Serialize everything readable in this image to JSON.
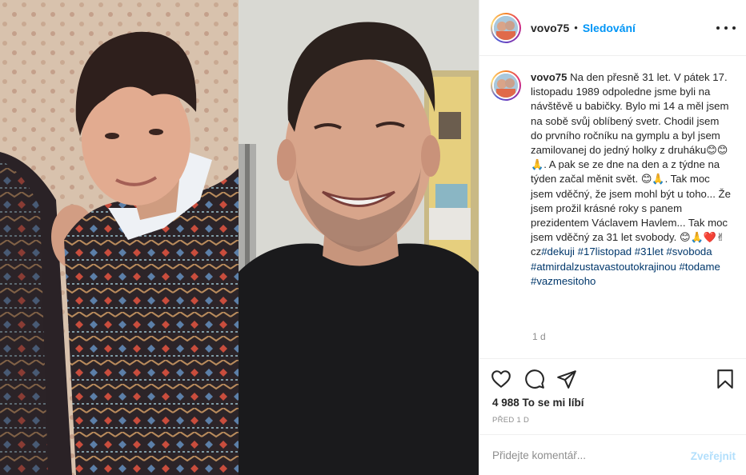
{
  "post": {
    "username": "vovo75",
    "separator": "•",
    "follow_label": "Sledování",
    "more_icon": "more-horizontal-icon"
  },
  "caption": {
    "username": "vovo75",
    "segments": [
      {
        "type": "text",
        "text": "Na den přesně 31 let. V pátek 17. listopadu 1989 odpoledne jsme byli na návštěvě u babičky. Bylo mi 14 a měl jsem na sobě svůj oblíbený svetr. Chodil jsem do prvního ročníku na gymplu a byl jsem zamilovanej do jedný holky z druháku"
      },
      {
        "type": "emoji",
        "text": "😊"
      },
      {
        "type": "emoji",
        "text": "😊"
      },
      {
        "type": "emoji",
        "text": "🙏"
      },
      {
        "type": "text",
        "text": ". A pak se ze dne na den a z týdne na týden začal měnit svět. "
      },
      {
        "type": "emoji",
        "text": "😊"
      },
      {
        "type": "emoji",
        "text": "🙏"
      },
      {
        "type": "text",
        "text": ". Tak moc jsem vděčný, že jsem mohl být u toho... Že jsem prožil krásné roky s panem prezidentem Václavem Havlem... Tak moc jsem vděčný za 31 let svobody. "
      },
      {
        "type": "emoji",
        "text": "😊"
      },
      {
        "type": "emoji",
        "text": "🙏"
      },
      {
        "type": "emoji",
        "text": "❤️"
      },
      {
        "type": "emoji",
        "text": "✌"
      },
      {
        "type": "text",
        "text": "cz"
      },
      {
        "type": "tag",
        "text": "#dekuji"
      },
      {
        "type": "text",
        "text": " "
      },
      {
        "type": "tag",
        "text": "#17listopad"
      },
      {
        "type": "text",
        "text": " "
      },
      {
        "type": "tag",
        "text": "#31let"
      },
      {
        "type": "text",
        "text": " "
      },
      {
        "type": "tag",
        "text": "#svoboda"
      },
      {
        "type": "text",
        "text": " "
      },
      {
        "type": "tag",
        "text": "#atmirdalzustavastoutokrajinou"
      },
      {
        "type": "text",
        "text": " "
      },
      {
        "type": "tag",
        "text": "#todame"
      },
      {
        "type": "text",
        "text": " "
      },
      {
        "type": "tag",
        "text": "#vazmesitoho"
      }
    ],
    "time": "1 d"
  },
  "actions": {
    "like_icon": "heart-icon",
    "comment_icon": "comment-icon",
    "share_icon": "paper-plane-icon",
    "save_icon": "bookmark-icon"
  },
  "likes": "4 988 To se mi líbí",
  "date": "před 1 d",
  "comment": {
    "placeholder": "Přidejte komentář...",
    "post_label": "Zveřejnit"
  },
  "colors": {
    "accent": "#0095f6",
    "hashtag": "#00376b",
    "muted": "#8e8e8e",
    "post_disabled": "#b2dffc"
  }
}
